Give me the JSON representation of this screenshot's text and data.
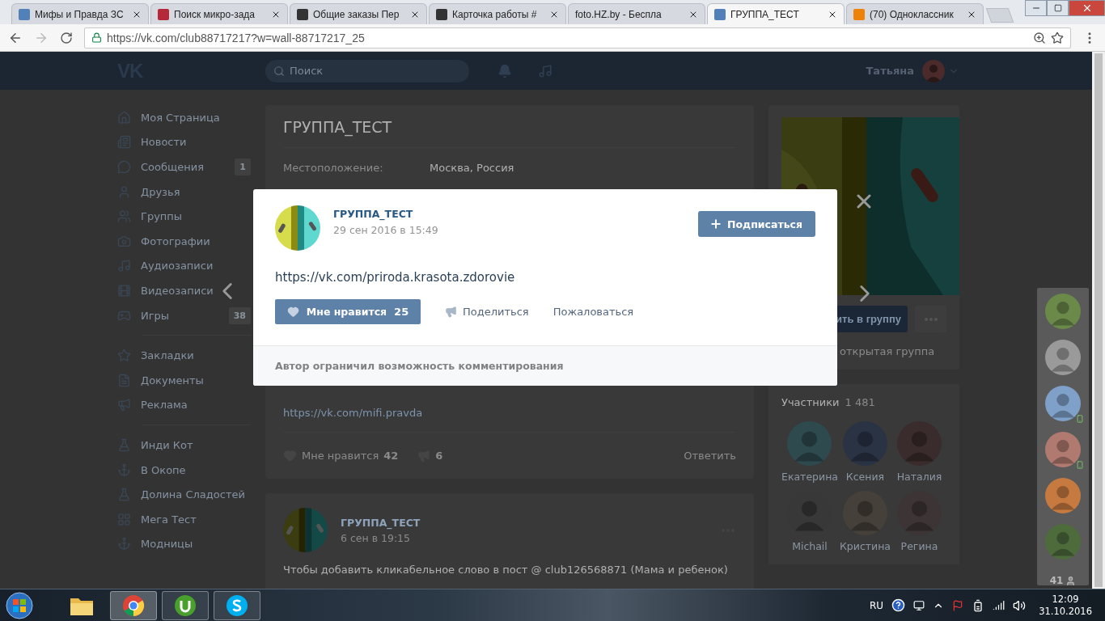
{
  "browser": {
    "tabs": [
      {
        "title": "Мифы и Правда ЗС",
        "kind": "vk",
        "selected": false
      },
      {
        "title": "Поиск микро-зада",
        "kind": "tt",
        "selected": false
      },
      {
        "title": "Общие заказы Пер",
        "kind": "dark",
        "selected": false
      },
      {
        "title": "Карточка работы #",
        "kind": "dark",
        "selected": false
      },
      {
        "title": "foto.HZ.by - Беспла",
        "kind": "none",
        "selected": false
      },
      {
        "title": "ГРУППА_ТЕСТ",
        "kind": "vk",
        "selected": true
      },
      {
        "title": "(70) Одноклассник",
        "kind": "ok",
        "selected": false
      }
    ],
    "url": "https://vk.com/club88717217?w=wall-88717217_25"
  },
  "header": {
    "logo": "VK",
    "search": {
      "placeholder": "Поиск"
    },
    "user": "Татьяна"
  },
  "sidebar": {
    "groups": [
      {
        "items": [
          {
            "label": "Моя Страница"
          },
          {
            "label": "Новости"
          },
          {
            "label": "Сообщения",
            "count": "1"
          },
          {
            "label": "Друзья"
          },
          {
            "label": "Группы"
          },
          {
            "label": "Фотографии"
          },
          {
            "label": "Аудиозаписи"
          },
          {
            "label": "Видеозаписи"
          },
          {
            "label": "Игры",
            "count": "38"
          }
        ]
      },
      {
        "items": [
          {
            "label": "Закладки"
          },
          {
            "label": "Документы"
          },
          {
            "label": "Реклама"
          }
        ]
      },
      {
        "items": [
          {
            "label": "Инди Кот"
          },
          {
            "label": "В Окопе"
          },
          {
            "label": "Долина Сладостей"
          },
          {
            "label": "Мега Тест"
          },
          {
            "label": "Модницы"
          }
        ]
      }
    ]
  },
  "group_card": {
    "title": "ГРУППА_ТЕСТ",
    "info": [
      {
        "label": "Местоположение:",
        "value": "Москва, Россия"
      }
    ],
    "post_link": "https://vk.com/mifi.pravda",
    "like_label": "Мне нравится",
    "likes": "42",
    "shares": "6",
    "reply": "Ответить"
  },
  "wall_post": {
    "author": "ГРУППА_ТЕСТ",
    "date": "6 сен в 19:15",
    "text": "Чтобы добавить кликабельное слово в пост @ club126568871 (Мама и ребенок)"
  },
  "group_side": {
    "join_button": "ить в группу",
    "group_type": "открытая группа"
  },
  "members": {
    "title": "Участники",
    "count": "1 481",
    "items": [
      {
        "name": "Екатерина"
      },
      {
        "name": "Ксения"
      },
      {
        "name": "Наталия"
      },
      {
        "name": "Michail"
      },
      {
        "name": "Кристина"
      },
      {
        "name": "Регина"
      }
    ]
  },
  "friends_bar": {
    "items": [
      {
        "mobile": false
      },
      {
        "mobile": false
      },
      {
        "mobile": true
      },
      {
        "mobile": true
      },
      {
        "mobile": false
      },
      {
        "mobile": false
      }
    ],
    "count": "41"
  },
  "modal": {
    "author": "ГРУППА_ТЕСТ",
    "date": "29 сен 2016 в 15:49",
    "subscribe": "Подписаться",
    "text": "https://vk.com/priroda.krasota.zdorovie",
    "like_label": "Мне нравится",
    "likes": "25",
    "share": "Поделиться",
    "report": "Пожаловаться",
    "notice": "Автор ограничил возможность комментирования"
  },
  "taskbar": {
    "apps": [
      {
        "kind": "explorer",
        "running": false,
        "active": false
      },
      {
        "kind": "chrome",
        "running": true,
        "active": true
      },
      {
        "kind": "utorrent",
        "running": true,
        "active": false
      },
      {
        "kind": "skype",
        "running": true,
        "active": false
      }
    ],
    "language": "RU",
    "time": "12:09",
    "date": "31.10.2016"
  }
}
